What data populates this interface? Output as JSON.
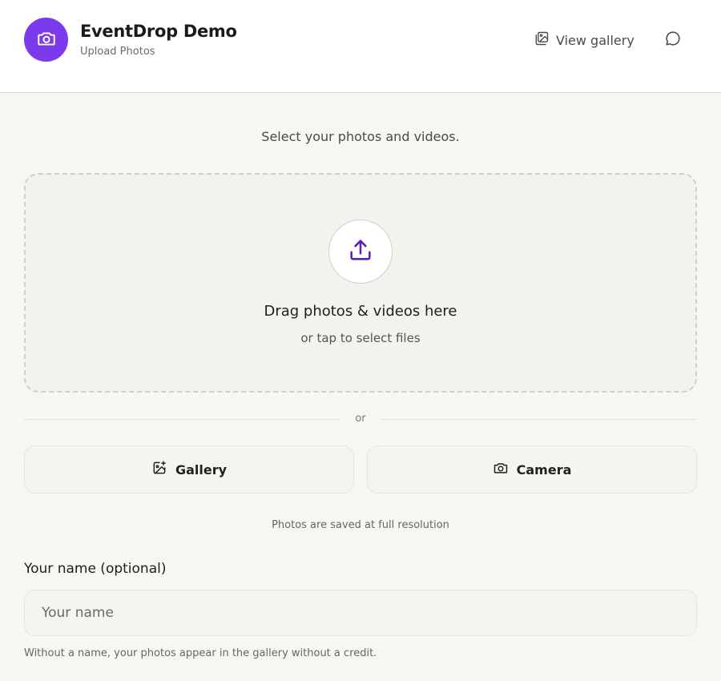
{
  "header": {
    "title": "EventDrop Demo",
    "subtitle": "Upload Photos",
    "view_gallery_label": "View gallery",
    "logo_icon": "camera-icon",
    "view_gallery_icon": "gallery-icon",
    "chat_icon": "chat-bubble-icon"
  },
  "main": {
    "prompt": "Select your photos and videos.",
    "dropzone": {
      "icon": "upload-icon",
      "title": "Drag photos & videos here",
      "subtitle": "or tap to select files"
    },
    "divider_text": "or",
    "buttons": {
      "gallery_label": "Gallery",
      "gallery_icon": "gallery-add-icon",
      "camera_label": "Camera",
      "camera_icon": "camera-icon"
    },
    "resolution_note": "Photos are saved at full resolution",
    "name_field": {
      "label": "Your name (optional)",
      "value": "",
      "placeholder": "Your name",
      "hint": "Without a name, your photos appear in the gallery without a credit."
    }
  },
  "colors": {
    "accent": "#7c3aed",
    "background": "#f7f6f1",
    "header_background": "#ffffff"
  }
}
